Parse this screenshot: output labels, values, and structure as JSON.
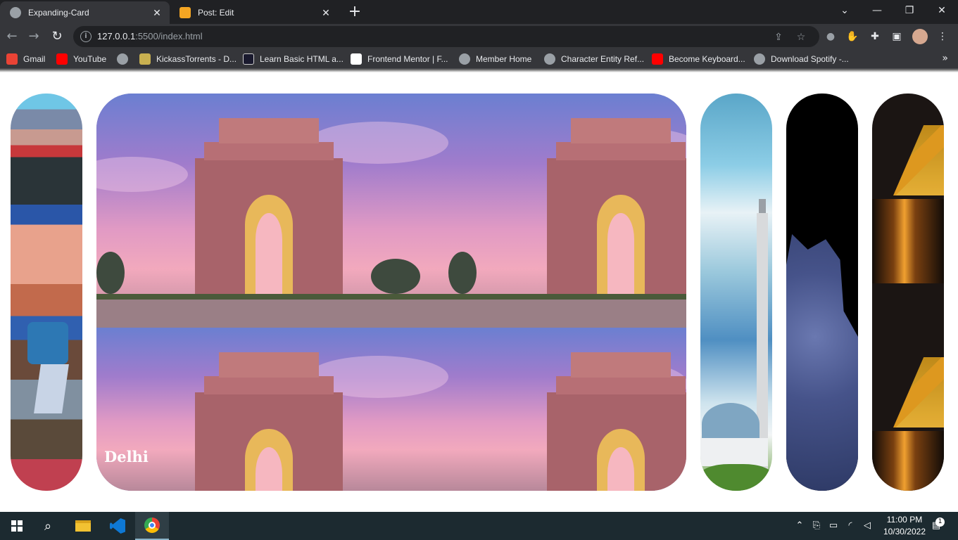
{
  "browser": {
    "tabs": [
      {
        "title": "Expanding-Card",
        "active": true
      },
      {
        "title": "Post: Edit",
        "active": false
      }
    ],
    "new_tab_icon": "plus-icon",
    "window_controls": [
      "chevron-down-icon",
      "minimize-icon",
      "restore-icon",
      "close-icon"
    ],
    "address": {
      "host": "127.0.0.1",
      "rest": ":5500/index.html"
    },
    "bookmarks": [
      {
        "label": "Gmail",
        "color": "#ea4335"
      },
      {
        "label": "YouTube",
        "color": "#ff0000"
      },
      {
        "label": "",
        "color": "#9aa0a6"
      },
      {
        "label": "KickassTorrents - D...",
        "color": "#c8b050"
      },
      {
        "label": "Learn Basic HTML a...",
        "color": "#1a1a2e"
      },
      {
        "label": "Frontend Mentor | F...",
        "color": "#ffffff"
      },
      {
        "label": "Member Home",
        "color": "#9aa0a6"
      },
      {
        "label": "Character Entity Ref...",
        "color": "#9aa0a6"
      },
      {
        "label": "Become Keyboard...",
        "color": "#ff0000"
      },
      {
        "label": "Download Spotify -...",
        "color": "#9aa0a6"
      }
    ],
    "bookmarks_more": "»"
  },
  "page": {
    "cards": [
      {
        "name": "slum",
        "label": ""
      },
      {
        "name": "delhi",
        "label": "Delhi"
      },
      {
        "name": "mosque",
        "label": ""
      },
      {
        "name": "night-sky",
        "label": ""
      },
      {
        "name": "bridge",
        "label": ""
      }
    ]
  },
  "taskbar": {
    "time": "11:00 PM",
    "date": "10/30/2022",
    "notification_count": "1",
    "accent": "#1c2a30"
  }
}
